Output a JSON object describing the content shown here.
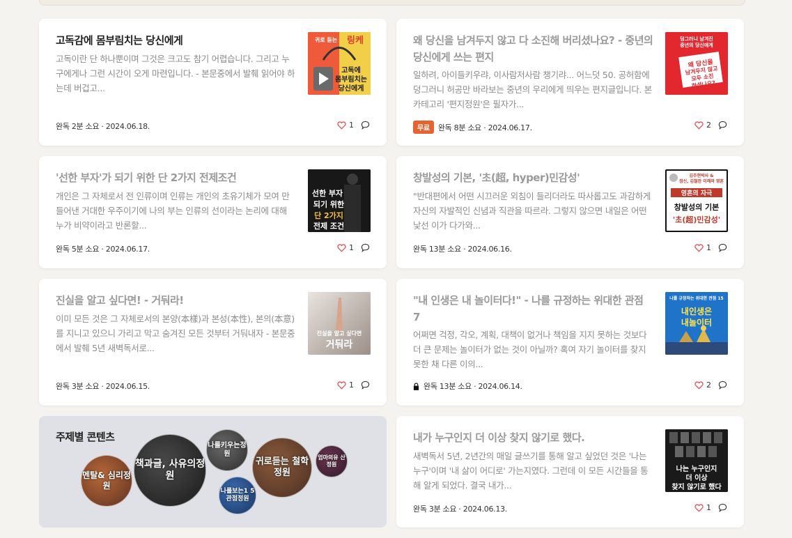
{
  "cards": [
    {
      "title": "고독감에 몸부림치는 당신에게",
      "desc": "고독이란 단 하나뿐이며 그것은 크고도 참기 어렵습니다. 그리고 누구에게나 그런 시간이 오게 마련입니다. - 본문중에서 발췌 읽어야 하는데 버겁고...",
      "meta": "완독 2분 소요 · 2024.06.18.",
      "likes": "1",
      "thumb_text": "귀로 듣는 \u0000 고독에 몸부림치는 당신에게"
    },
    {
      "title": "왜 당신을 남겨두지 않고 다 소진해 버리셨나요? - 중년의 당신에게 쓰는 편지",
      "desc": "일하려, 아이들키우랴, 이사람저사람 챙기랴... 어느덧 50. 공허함에 덩그러니 허공만 바라보는 중년의 우리에게 띄우는 편지글입니다. 본 카테고리 '편지정원'은 필자가...",
      "badge": "무료",
      "meta": "완독 8분 소요 · 2024.06.17.",
      "likes": "2",
      "thumb_text": "왜 당신을 남겨두지 않고 모두 소진하셨나요?"
    },
    {
      "title": "'선한 부자'가 되기 위한 단 2가지 전제조건",
      "desc": "개인은 그 자체로서 전 인류이며 인류는 개인의 초유기체가 모여 만들어낸 거대한 우주이기에 나의 부는 인류의 선이라는 논리에 대해 누가 비약이라고 반론할...",
      "meta": "완독 5분 소요 · 2024.06.17.",
      "likes": "1",
      "thumb_text": "선한 부자 되기 위한 단 2가지 전제 조건"
    },
    {
      "title": "창발성의 기본, '초(超, hyper)민감성'",
      "desc": "\"반대편에서 어떤 시끄러운 외침이 들리더라도 따사롭고도 과감하게 자신의 자발적인 신념과 직관을 따르라. 그렇지 않으면 내일은 어떤 낯선 이가 다가와...",
      "meta": "완독 13분 소요 · 2024.06.16.",
      "likes": "1",
      "thumb_text": "영혼의 자극 창발성의 기본 '초(超)민감성'"
    },
    {
      "title": "진실을 알고 싶다면! - 거둬라!",
      "desc": "이미 모든 것은 그 자체로서의 본양(本樣)과 본성(本性), 본의(本意)를 지니고 있으니 가리고 막고 숨겨진 모든 것부터 거둬내자 - 본문중에서 발췌 5년 새벽독서로...",
      "meta": "완독 3분 소요 · 2024.06.15.",
      "likes": "1",
      "thumb_text": "진실을 알고 싶다면 거둬라"
    },
    {
      "title": "\"내 인생은 내 놀이터다!\" - 나를 규정하는 위대한 관점 7",
      "desc": "어쩌면 걱정, 각오, 계획, 대책이 없거나 책임을 지지 못하는 것보다 더 큰 문제는 놀이터가 없는 것이 아닐까? 혹여 자기 놀이터를 찾지 못한 채 다른 이의...",
      "meta": "완독 13분 소요 · 2024.06.14.",
      "likes": "2",
      "thumb_text": "내인생은 내놀이터"
    },
    {
      "title": "내가 누구인지 더 이상 찾지 않기로 했다.",
      "desc": "새벽독서 5년, 2년간의 매일 글쓰기를 통해 알고 싶었던 것은 '나는 누구'이며 '내 삶이 어디로' 가는지였다. 그런데 이 모든 시간들을 통해 알게 되었다. 결국 내가...",
      "meta": "완독 3분 소요 · 2024.06.13.",
      "likes": "1",
      "thumb_text": "나는 누구인지 더 이상 찾지 않기로 했다"
    }
  ],
  "topics": {
    "title": "주제별 콘텐츠",
    "items": [
      "멘탈& 심리정원",
      "책과글, 사유의정원",
      "나를키우는정원",
      "나를보는1 5관점정원",
      "귀로듣는 철학정원",
      "엄마의유 산정원"
    ]
  },
  "icons": {
    "heart": "heart-icon",
    "comment": "comment-icon",
    "lock": "lock-icon"
  }
}
